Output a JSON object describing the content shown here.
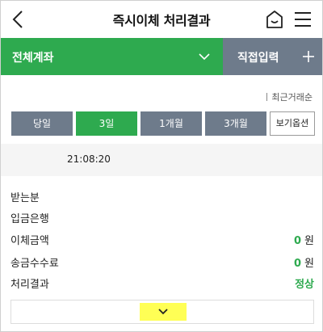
{
  "header": {
    "title": "즉시이체 처리결과"
  },
  "account_bar": {
    "account_label": "전체계좌",
    "direct_label": "직접입력"
  },
  "sort": {
    "label": "최근거래순"
  },
  "period": {
    "buttons": [
      "당일",
      "3일",
      "1개월",
      "3개월"
    ],
    "active": "3일",
    "options_label": "보기옵션"
  },
  "record": {
    "time": "21:08:20",
    "rows": [
      {
        "label": "받는분",
        "value": "",
        "unit": ""
      },
      {
        "label": "입금은행",
        "value": "",
        "unit": ""
      },
      {
        "label": "이체금액",
        "value": "0",
        "unit": "원"
      },
      {
        "label": "송금수수료",
        "value": "0",
        "unit": "원"
      },
      {
        "label": "처리결과",
        "value": "정상",
        "unit": ""
      }
    ]
  },
  "colors": {
    "accent_green": "#2eaa4f",
    "slate_gray": "#6e7b8b",
    "highlight_yellow": "#ffff55"
  },
  "icons": {
    "back": "chevron-left-icon",
    "home": "home-icon",
    "menu": "hamburger-menu-icon",
    "account_dropdown": "chevron-down-icon",
    "direct_add": "plus-icon",
    "expand": "chevron-down-icon"
  }
}
